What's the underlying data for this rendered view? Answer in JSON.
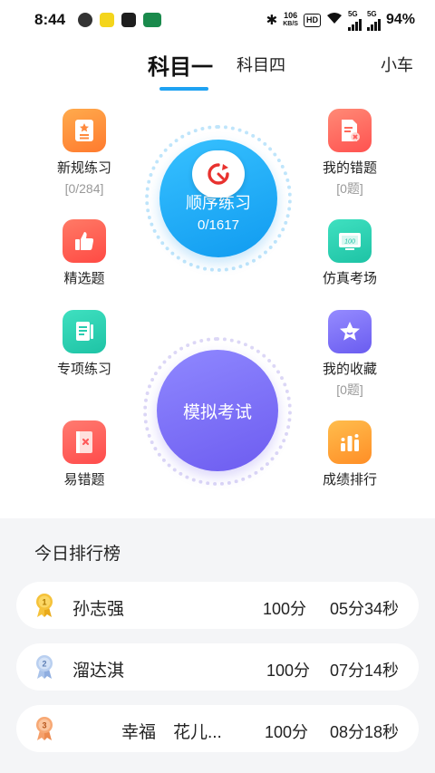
{
  "status_bar": {
    "time": "8:44",
    "speed": "106",
    "speed_unit": "KB/S",
    "hd": "HD",
    "net1": "5G",
    "net2": "5G",
    "battery": "94%"
  },
  "tabs": [
    {
      "label": "科目一",
      "active": true
    },
    {
      "label": "科目四",
      "active": false
    },
    {
      "label": "小车",
      "active": false
    }
  ],
  "left_items": [
    {
      "label": "新规练习",
      "sub": "[0/284]",
      "icon": "clipboard-star-icon",
      "color": "#ff8a3d"
    },
    {
      "label": "精选题",
      "sub": "",
      "icon": "thumbs-up-icon",
      "color": "#ff5a4e"
    },
    {
      "label": "专项练习",
      "sub": "",
      "icon": "document-pen-icon",
      "color": "#27cdb0"
    },
    {
      "label": "易错题",
      "sub": "",
      "icon": "book-x-icon",
      "color": "#ff5a5a"
    }
  ],
  "right_items": [
    {
      "label": "我的错题",
      "sub": "[0题]",
      "icon": "document-x-icon",
      "color": "#ff6a5a"
    },
    {
      "label": "仿真考场",
      "sub": "",
      "icon": "exam-screen-icon",
      "color": "#27cdb0"
    },
    {
      "label": "我的收藏",
      "sub": "[0题]",
      "icon": "star-icon",
      "color": "#7b6cf5"
    },
    {
      "label": "成绩排行",
      "sub": "",
      "icon": "bar-chart-icon",
      "color": "#ff9a2e"
    }
  ],
  "practice": {
    "title": "顺序练习",
    "count": "0/1617"
  },
  "mock_exam": {
    "title": "模拟考试"
  },
  "ranking": {
    "title": "今日排行榜",
    "rows": [
      {
        "rank": "1",
        "name": "孙志强",
        "score": "100分",
        "time": "05分34秒",
        "medal_color": "#f5c23a"
      },
      {
        "rank": "2",
        "name": "溜达淇",
        "score": "100分",
        "time": "07分14秒",
        "medal_color": "#a9c3ea"
      },
      {
        "rank": "3",
        "name": "幸福　花儿...",
        "score": "100分",
        "time": "08分18秒",
        "medal_color": "#f5a06b"
      }
    ]
  }
}
